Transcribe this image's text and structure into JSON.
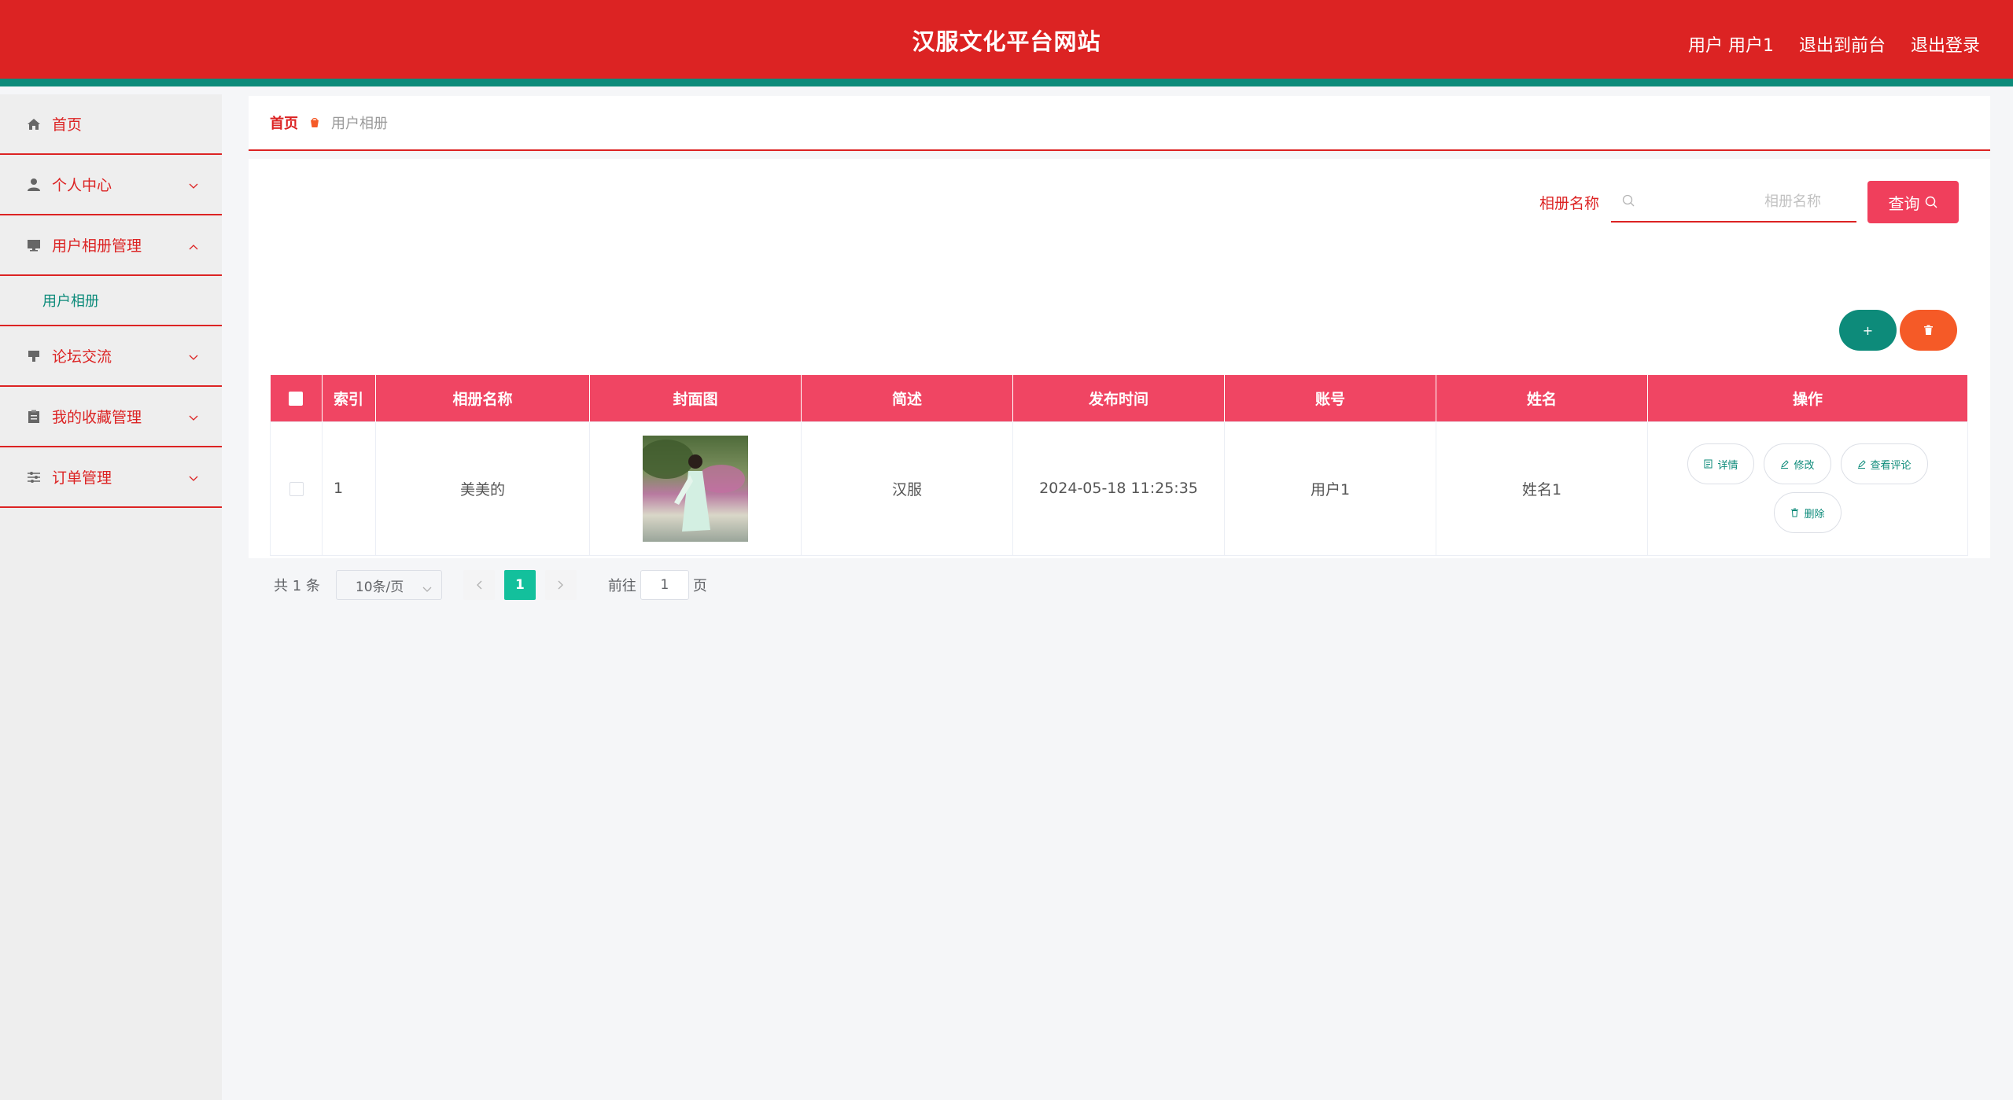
{
  "header": {
    "title": "汉服文化平台网站",
    "user_label": "用户 用户1",
    "front_label": "退出到前台",
    "logout_label": "退出登录"
  },
  "sidebar": {
    "items": [
      {
        "label": "首页",
        "icon": "home-icon"
      },
      {
        "label": "个人中心",
        "icon": "user-icon"
      },
      {
        "label": "用户相册管理",
        "icon": "monitor-icon"
      },
      {
        "label": "用户相册",
        "icon": ""
      },
      {
        "label": "论坛交流",
        "icon": "chat-icon"
      },
      {
        "label": "我的收藏管理",
        "icon": "clipboard-icon"
      },
      {
        "label": "订单管理",
        "icon": "sliders-icon"
      }
    ]
  },
  "breadcrumb": {
    "home": "首页",
    "current": "用户相册"
  },
  "search": {
    "label": "相册名称",
    "placeholder": "相册名称",
    "button": "查询"
  },
  "actions": {
    "add": "+",
    "delete_icon": "trash-icon"
  },
  "table": {
    "headers": [
      "索引",
      "相册名称",
      "封面图",
      "简述",
      "发布时间",
      "账号",
      "姓名",
      "操作"
    ],
    "rows": [
      {
        "index": "1",
        "name": "美美的",
        "summary": "汉服",
        "publish_time": "2024-05-18 11:25:35",
        "account": "用户1",
        "full_name": "姓名1",
        "ops": {
          "detail": "详情",
          "edit": "修改",
          "comments": "查看评论",
          "delete": "删除"
        }
      }
    ]
  },
  "pagination": {
    "total": "共 1 条",
    "page_size": "10条/页",
    "current_page": "1",
    "goto_prefix": "前往",
    "goto_value": "1",
    "goto_suffix": "页"
  },
  "colors": {
    "header_red": "#dc2323",
    "accent_teal": "#0d8b7a",
    "table_head": "#f04563",
    "delete_orange": "#f55a27",
    "page_active": "#13c09c"
  }
}
